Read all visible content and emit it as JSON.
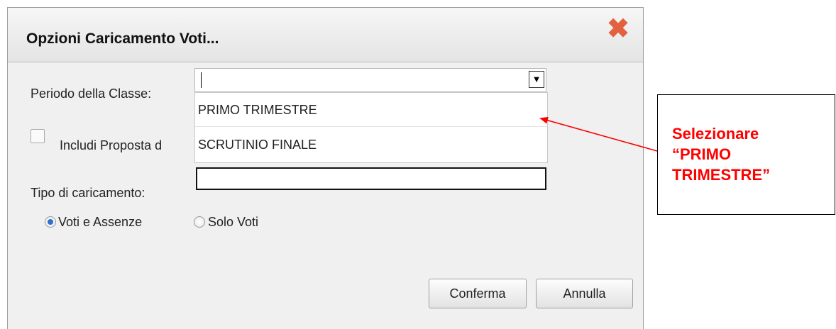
{
  "dialog": {
    "title": "Opzioni Caricamento Voti...",
    "close_icon": "close-icon",
    "close_color": "#e2613e"
  },
  "periodo": {
    "label": "Periodo della Classe:",
    "value": "",
    "options": [
      "PRIMO TRIMESTRE",
      "SCRUTINIO FINALE"
    ],
    "dropdown_icon": "chevron-down-icon"
  },
  "includi": {
    "label": "Includi Proposta d",
    "checked": false
  },
  "tipo": {
    "label": "Tipo di caricamento:",
    "value": "",
    "radios": [
      {
        "label": "Voti e Assenze",
        "selected": true
      },
      {
        "label": "Solo Voti",
        "selected": false
      }
    ]
  },
  "buttons": {
    "confirm": "Conferma",
    "cancel": "Annulla"
  },
  "callout": {
    "line1": "Selezionare",
    "line2": "“PRIMO",
    "line3": "TRIMESTRE”",
    "color": "#ff0000"
  }
}
